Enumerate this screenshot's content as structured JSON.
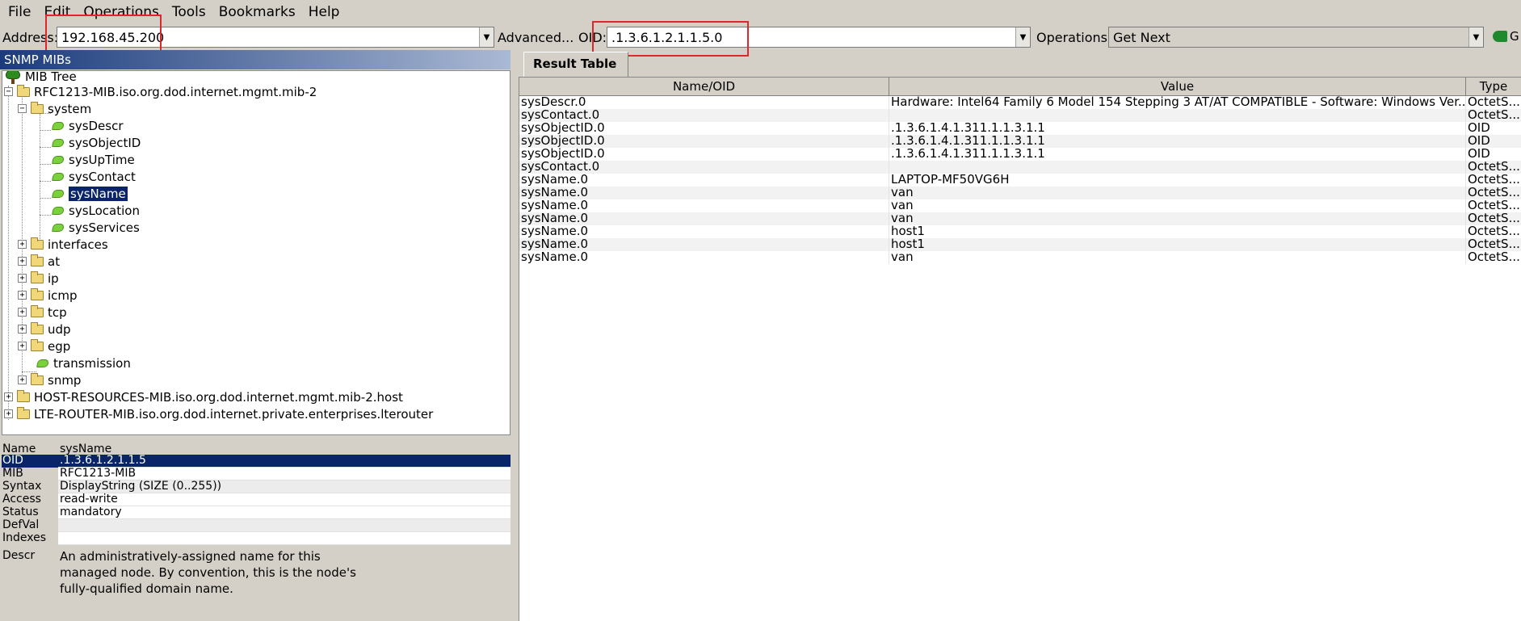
{
  "menubar": {
    "items": [
      {
        "label": "File"
      },
      {
        "label": "Edit"
      },
      {
        "label": "Operations"
      },
      {
        "label": "Tools"
      },
      {
        "label": "Bookmarks"
      },
      {
        "label": "Help"
      }
    ]
  },
  "toolbar": {
    "address_label": "Address:",
    "address_value": "192.168.45.200",
    "advanced_label": "Advanced...",
    "oid_label": "OID:",
    "oid_value": ".1.3.6.1.2.1.1.5.0",
    "operations_label": "Operations:",
    "operations_value": "Get Next",
    "go_label": "G"
  },
  "left_panel": {
    "title": "SNMP MIBs",
    "tree": {
      "root": "MIB Tree",
      "rfc1213": "RFC1213-MIB.iso.org.dod.internet.mgmt.mib-2",
      "system": "system",
      "system_children": [
        "sysDescr",
        "sysObjectID",
        "sysUpTime",
        "sysContact",
        "sysName",
        "sysLocation",
        "sysServices"
      ],
      "selected": "sysName",
      "groups": [
        "interfaces",
        "at",
        "ip",
        "icmp",
        "tcp",
        "udp",
        "egp"
      ],
      "transmission": "transmission",
      "snmp": "snmp",
      "host_resources": "HOST-RESOURCES-MIB.iso.org.dod.internet.mgmt.mib-2.host",
      "lte_router": "LTE-ROUTER-MIB.iso.org.dod.internet.private.enterprises.lterouter"
    }
  },
  "properties": {
    "rows": [
      {
        "key": "Name",
        "value": "sysName"
      },
      {
        "key": "OID",
        "value": ".1.3.6.1.2.1.1.5"
      },
      {
        "key": "MIB",
        "value": "RFC1213-MIB"
      },
      {
        "key": "Syntax",
        "value": "DisplayString (SIZE (0..255))"
      },
      {
        "key": "Access",
        "value": "read-write"
      },
      {
        "key": "Status",
        "value": "mandatory"
      },
      {
        "key": "DefVal",
        "value": ""
      },
      {
        "key": "Indexes",
        "value": ""
      }
    ],
    "descr_key": "Descr",
    "descr_value": "An administratively-assigned name for this\nmanaged node.  By convention, this is the node's\nfully-qualified domain name."
  },
  "result": {
    "tab_label": "Result Table",
    "columns": [
      "Name/OID",
      "Value",
      "Type"
    ],
    "rows": [
      {
        "name": "sysDescr.0",
        "value": "Hardware: Intel64 Family 6 Model 154 Stepping 3 AT/AT COMPATIBLE - Software: Windows Ver...",
        "type": "OctetS..."
      },
      {
        "name": "sysContact.0",
        "value": "",
        "type": "OctetS..."
      },
      {
        "name": "sysObjectID.0",
        "value": ".1.3.6.1.4.1.311.1.1.3.1.1",
        "type": "OID"
      },
      {
        "name": "sysObjectID.0",
        "value": ".1.3.6.1.4.1.311.1.1.3.1.1",
        "type": "OID"
      },
      {
        "name": "sysObjectID.0",
        "value": ".1.3.6.1.4.1.311.1.1.3.1.1",
        "type": "OID"
      },
      {
        "name": "sysContact.0",
        "value": "",
        "type": "OctetS..."
      },
      {
        "name": "sysName.0",
        "value": "LAPTOP-MF50VG6H",
        "type": "OctetS..."
      },
      {
        "name": "sysName.0",
        "value": "van",
        "type": "OctetS..."
      },
      {
        "name": "sysName.0",
        "value": "van",
        "type": "OctetS..."
      },
      {
        "name": "sysName.0",
        "value": "van",
        "type": "OctetS..."
      },
      {
        "name": "sysName.0",
        "value": "host1",
        "type": "OctetS..."
      },
      {
        "name": "sysName.0",
        "value": "host1",
        "type": "OctetS..."
      },
      {
        "name": "sysName.0",
        "value": "van",
        "type": "OctetS..."
      }
    ]
  },
  "colors": {
    "highlight": "#e0262b",
    "selection": "#0a246a"
  }
}
